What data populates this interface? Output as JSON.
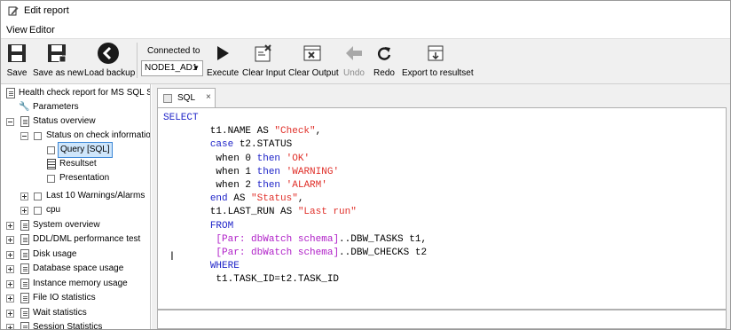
{
  "window": {
    "title": "Edit report"
  },
  "menu": [
    "View",
    "Editor"
  ],
  "toolbar": {
    "save": "Save",
    "save_as_new": "Save as new",
    "load_backup": "Load backup",
    "connected_to": "Connected to",
    "connection": "NODE1_AD1",
    "execute": "Execute",
    "clear_input": "Clear Input",
    "clear_output": "Clear Output",
    "undo": "Undo",
    "redo": "Redo",
    "export": "Export to resultset"
  },
  "tree": [
    "Health check report for MS SQL Serv",
    "Parameters",
    "Status overview",
    "Status on check information",
    "Query [SQL]",
    "Resultset",
    "Presentation",
    "Last 10 Warnings/Alarms",
    "cpu",
    "System overview",
    "DDL/DML performance test",
    "Disk usage",
    "Database space usage",
    "Instance memory usage",
    "File IO statistics",
    "Wait statistics",
    "Session Statistics"
  ],
  "editor": {
    "tab_label": "SQL",
    "tab_close": "×",
    "code": [
      [
        {
          "t": "SELECT",
          "c": "kw"
        }
      ],
      [
        {
          "t": "        t1.NAME AS ",
          "c": ""
        },
        {
          "t": "\"Check\"",
          "c": "str"
        },
        {
          "t": ",",
          "c": ""
        }
      ],
      [
        {
          "t": "        ",
          "c": ""
        },
        {
          "t": "case",
          "c": "kw"
        },
        {
          "t": " t2.STATUS",
          "c": ""
        }
      ],
      [
        {
          "t": "         when 0 ",
          "c": ""
        },
        {
          "t": "then",
          "c": "kw"
        },
        {
          "t": " ",
          "c": ""
        },
        {
          "t": "'OK'",
          "c": "str"
        }
      ],
      [
        {
          "t": "         when 1 ",
          "c": ""
        },
        {
          "t": "then",
          "c": "kw"
        },
        {
          "t": " ",
          "c": ""
        },
        {
          "t": "'WARNING'",
          "c": "str"
        }
      ],
      [
        {
          "t": "         when 2 ",
          "c": ""
        },
        {
          "t": "then",
          "c": "kw"
        },
        {
          "t": " ",
          "c": ""
        },
        {
          "t": "'ALARM'",
          "c": "str"
        }
      ],
      [
        {
          "t": "        ",
          "c": ""
        },
        {
          "t": "end",
          "c": "kw"
        },
        {
          "t": " AS ",
          "c": ""
        },
        {
          "t": "\"Status\"",
          "c": "str"
        },
        {
          "t": ",",
          "c": ""
        }
      ],
      [
        {
          "t": "        t1.LAST_RUN AS ",
          "c": ""
        },
        {
          "t": "\"Last run\"",
          "c": "str"
        }
      ],
      [
        {
          "t": "        ",
          "c": ""
        },
        {
          "t": "FROM",
          "c": "kw"
        }
      ],
      [
        {
          "t": "         ",
          "c": ""
        },
        {
          "t": "[Par: dbWatch schema]",
          "c": "par"
        },
        {
          "t": "..DBW_TASKS t1,",
          "c": ""
        }
      ],
      [
        {
          "t": "         ",
          "c": ""
        },
        {
          "t": "[Par: dbWatch schema]",
          "c": "par"
        },
        {
          "t": "..DBW_CHECKS t2",
          "c": ""
        }
      ],
      [
        {
          "t": "        ",
          "c": ""
        },
        {
          "t": "WHERE",
          "c": "kw"
        }
      ],
      [
        {
          "t": "         t1.TASK_ID=t2.TASK_ID",
          "c": ""
        }
      ]
    ]
  },
  "colors": {
    "keyword": "#1f24c8",
    "string": "#e0302a",
    "parameter": "#b020c8",
    "selection": "#cfe6fb"
  }
}
